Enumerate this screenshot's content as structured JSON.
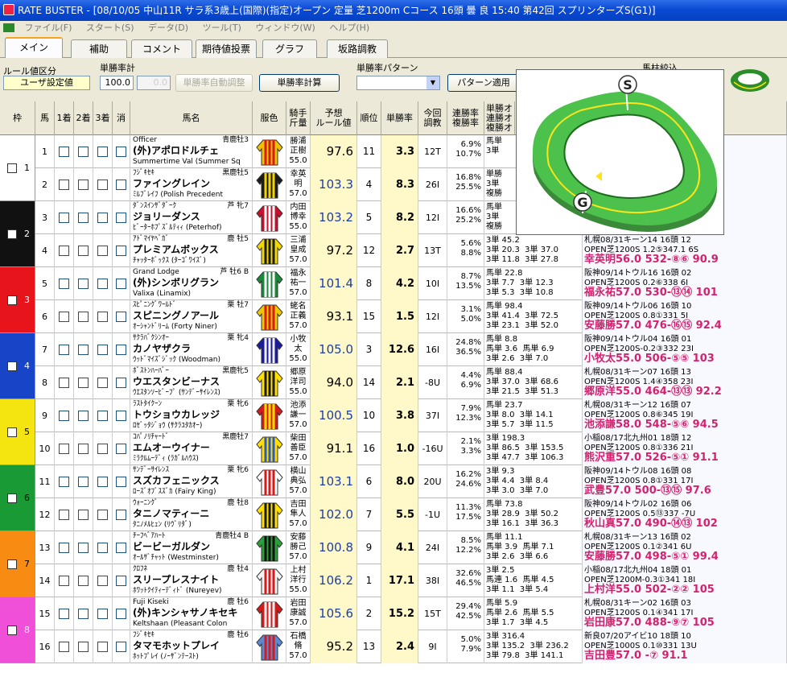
{
  "title": "RATE BUSTER - [08/10/05 中山11R サラ系3歳上(国際)(指定)オープン 定量 芝1200m Cコース 16頭 曇 良 15:40 第42回 スプリンターズS(G1)]",
  "menu": [
    "ファイル(F)",
    "スタート(S)",
    "データ(D)",
    "ツール(T)",
    "ウィンドウ(W)",
    "ヘルプ(H)"
  ],
  "tabs": [
    "メイン",
    "補助",
    "コメント",
    "期待値投票",
    "グラフ",
    "坂路調教"
  ],
  "toolbar": {
    "rule_label": "ルール値区分",
    "rule_value": "ユーザ設定値",
    "tansho_label": "単勝率計",
    "tansho_value": "100.0",
    "tansho_value2": "0.0",
    "auto_adjust": "単勝率自動調整",
    "calc": "単勝率計算",
    "pattern_label": "単勝率パターン",
    "pattern_apply": "パターン適用",
    "horse_filter": "馬柱絞込"
  },
  "headers": [
    "枠",
    "馬",
    "1着",
    "2着",
    "3着",
    "消",
    "馬名",
    "服色",
    "騎手\n斤量",
    "予想\nルール値",
    "順位",
    "単勝率",
    "今回\n調教",
    "連勝率\n複勝率",
    "単勝オ\n連勝オ\n複勝オ"
  ],
  "colors": {
    "frame": [
      "#ffffff",
      "#111111",
      "#e8141c",
      "#1844c8",
      "#f4e410",
      "#1a9a34",
      "#f88c12",
      "#f050d8"
    ]
  },
  "frames": [
    "1",
    "2",
    "3",
    "4",
    "5",
    "6",
    "7",
    "8"
  ],
  "rows": [
    {
      "no": "1",
      "sire": "Officer",
      "sex": "青鹿牡3",
      "name": "(外)アポロドルチェ",
      "dam": "Summertime Val (Summer Sq",
      "jockey": "勝浦\n正樹",
      "weight": "55.0",
      "rule": "97.6",
      "rank": "11",
      "odds": "3.3",
      "train": "12T",
      "rate1": "6.9%",
      "rate2": "10.7%",
      "bet": "馬単\n3単",
      "pv1": "11",
      "pv2": "B 17T",
      "pv3": "96.1"
    },
    {
      "no": "2",
      "sire": "ﾌｼﾞｷｾｷ",
      "sex": "黒鹿牡5",
      "name": "ファイングレイン",
      "dam": "ﾐﾙﾌﾞﾚｲﾌ (Polish Precedent",
      "jockey": "幸英\n明",
      "weight": "57.0",
      "rule": "103.3",
      "rank": "4",
      "odds": "8.3",
      "train": "26I",
      "rate1": "16.8%",
      "rate2": "25.5%",
      "bet": "単勝\n3単\n複勝",
      "pv1": "09",
      "pv2": "14I",
      "pv3": "98.1"
    },
    {
      "no": "3",
      "sire": "ﾀﾞﾝｽｲﾝｻﾞﾀﾞｰｸ",
      "sex": "芦 牝7",
      "name": "ジョリーダンス",
      "dam": "ﾋﾞｰﾀｰﾎﾌﾟｽﾞﾙﾃｨｨ (Peterhof)",
      "jockey": "内田\n博幸",
      "weight": "55.0",
      "rule": "103.2",
      "rank": "5",
      "odds": "8.2",
      "train": "12I",
      "rate1": "16.6%",
      "rate2": "25.2%",
      "bet": "馬単\n3単\n複勝",
      "pv1": "04",
      "pv2": "17I",
      "pv3": "102"
    },
    {
      "no": "4",
      "sire": "ｱﾄﾞﾏｲﾔﾍﾞｶﾞ",
      "sex": "鹿 牡5",
      "name": "プレミアムボックス",
      "dam": "ﾁｬｯﾀｰﾎﾞｯｸｽ (ﾀｰｺﾞﾜｲｽﾞ)",
      "jockey": "三浦\n皇成",
      "weight": "57.0",
      "rule": "97.2",
      "rank": "12",
      "odds": "2.7",
      "train": "13T",
      "rate1": "5.6%",
      "rate2": "8.8%",
      "bet": "3単 45.2\n3単 20.3  3単 37.0\n3単 11.8  3単 27.8",
      "pv1": "札幌08/31キーン14 16頭 12",
      "pv2": "OPEN芝1200S 1.2⑤347.1 6S",
      "pv3": "幸英明56.0 532-⑧⑥ 90.9"
    },
    {
      "no": "5",
      "sire": "Grand Lodge",
      "sex": "芦 牡6 B",
      "name": "(外)シンボリグラン",
      "dam": "Valixa (Linamix)",
      "jockey": "福永\n祐一",
      "weight": "57.0",
      "rule": "101.4",
      "rank": "8",
      "odds": "4.2",
      "train": "10I",
      "rate1": "8.7%",
      "rate2": "13.5%",
      "bet": "馬単 22.8\n3単 7.7  3単 12.3\n3単 5.3  3単 10.8",
      "pv1": "阪神09/14トウル16 16頭 02",
      "pv2": "OPEN芝1200S 0.2⑥338 6I",
      "pv3": "福永祐57.0 530-⑬⑭ 101"
    },
    {
      "no": "6",
      "sire": "ｽﾋﾟﾆﾝｸﾞﾜｰﾙﾄﾞ",
      "sex": "栗 牡7",
      "name": "スピニングノアール",
      "dam": "ｵｰｼｬﾝﾄﾞﾘｰﾑ (Forty Niner)",
      "jockey": "蛯名\n正義",
      "weight": "57.0",
      "rule": "93.1",
      "rank": "15",
      "odds": "1.5",
      "train": "12I",
      "rate1": "3.1%",
      "rate2": "5.0%",
      "bet": "馬単 98.4\n3単 41.4  3単 72.5\n3単 23.1  3単 52.0",
      "pv1": "阪神09/14トウル06 16頭 10",
      "pv2": "OPEN芝1200S 0.8①331 5I",
      "pv3": "安藤勝57.0 476-⑯⑮ 92.4"
    },
    {
      "no": "7",
      "sire": "ｻｸﾗﾊﾞｸｼﾝｵｰ",
      "sex": "栗 牝4",
      "name": "カノヤザクラ",
      "dam": "ｳｯﾄﾞﾏｲｽﾞｼﾞｯｸ (Woodman)",
      "jockey": "小牧\n太",
      "weight": "55.0",
      "rule": "105.0",
      "rank": "3",
      "odds": "12.6",
      "train": "16I",
      "rate1": "24.8%",
      "rate2": "36.5%",
      "bet": "馬単 8.8\n馬単 3.6  馬単 6.9\n3単 2.6  3単 7.0",
      "pv1": "阪神09/14トウル04 16頭 01",
      "pv2": "OPEN芝1200S-0.2③332 23I",
      "pv3": "小牧太55.0 506-⑤⑤ 103"
    },
    {
      "no": "8",
      "sire": "ﾎﾞｽﾄﾝﾊｰﾊﾞｰ",
      "sex": "黒鹿牝5",
      "name": "ウエスタンビーナス",
      "dam": "ｳｴｽﾀﾝｿｰﾋﾞｰﾌﾟ (ｻﾝﾃﾞｰｻｲﾚﾝｽ)",
      "jockey": "郷原\n洋司",
      "weight": "55.0",
      "rule": "94.0",
      "rank": "14",
      "odds": "2.1",
      "train": "-8U",
      "rate1": "4.4%",
      "rate2": "6.9%",
      "bet": "馬単 88.4\n3単 37.0  3単 68.6\n3単 21.5  3単 51.3",
      "pv1": "札幌08/31キーン07 16頭 13",
      "pv2": "OPEN芝1200S 1.4④358 23I",
      "pv3": "郷原洋55.0 464-⑬⑬ 92.2"
    },
    {
      "no": "9",
      "sire": "ﾗｽﾄﾀｲｸｰﾝ",
      "sex": "栗 牝6",
      "name": "トウショウカレッジ",
      "dam": "ﾛｾﾞｯﾀｼﾞｮｳ (ｻｸﾗﾕﾀｶｵｰ)",
      "jockey": "池添\n謙一",
      "weight": "57.0",
      "rule": "100.5",
      "rank": "10",
      "odds": "3.8",
      "train": "37I",
      "rate1": "7.9%",
      "rate2": "12.3%",
      "bet": "馬単 23.7\n3単 8.0  3単 14.1\n3単 5.7  3単 11.5",
      "pv1": "札幌08/31キーン12 16頭 07",
      "pv2": "OPEN芝1200S 0.8⑥345 19I",
      "pv3": "池添謙58.0 548-⑤⑥ 94.5"
    },
    {
      "no": "10",
      "sire": "ｺﾊﾟﾉﾘﾁｬｰﾄﾞ",
      "sex": "黒鹿牡7",
      "name": "エムオーウイナー",
      "dam": "ﾐﾗｸﾙﾑｰﾃﾞｨ (ﾗｶﾞﾙﾊｳｽ)",
      "jockey": "柴田\n善臣",
      "weight": "57.0",
      "rule": "91.1",
      "rank": "16",
      "odds": "1.0",
      "train": "-16U",
      "rate1": "2.1%",
      "rate2": "3.3%",
      "bet": "3単 198.3\n3単 86.5  3単 153.5\n3単 47.7  3単 106.3",
      "pv1": "小稲08/17北九州01 18頭 12",
      "pv2": "OPEN芝1200S 0.8①336 21I",
      "pv3": "熊沢重57.0 526-⑤① 91.1"
    },
    {
      "no": "11",
      "sire": "ｻﾝﾃﾞｰｻｲﾚﾝｽ",
      "sex": "栗 牝6",
      "name": "スズカフェニックス",
      "dam": "ﾛｰｽﾞｵﾌﾞｽｽﾞｶ (Fairy King)",
      "jockey": "横山\n典弘",
      "weight": "57.0",
      "rule": "103.1",
      "rank": "6",
      "odds": "8.0",
      "train": "20U",
      "rate1": "16.2%",
      "rate2": "24.6%",
      "bet": "3単 9.3\n3単 4.4  3単 8.4\n3単 3.0  3単 7.0",
      "pv1": "阪神09/14トウル08 16頭 08",
      "pv2": "OPEN芝1200S 0.8①331 17I",
      "pv3": "武豊57.0 500-⑬⑮ 97.6"
    },
    {
      "no": "12",
      "sire": "ｳｫｰﾆﾝｸﾞ",
      "sex": "鹿 牡8",
      "name": "タニノマティーニ",
      "dam": "ﾀﾆﾉﾒﾙﾋｪﾝ (ﾘｳﾞﾘﾀﾞ)",
      "jockey": "吉田\n隼人",
      "weight": "57.0",
      "rule": "102.0",
      "rank": "7",
      "odds": "5.5",
      "train": "-1U",
      "rate1": "11.3%",
      "rate2": "17.5%",
      "bet": "馬単 73.8\n3単 28.9  3単 50.2\n3単 16.1  3単 36.3",
      "pv1": "阪神09/14トウル02 16頭 06",
      "pv2": "OPEN芝1200S 0.5⑬337 -7U",
      "pv3": "秋山真57.0 490-⑭⑬ 102"
    },
    {
      "no": "13",
      "sire": "ﾁｰﾌﾍﾞｱﾊｰﾄ",
      "sex": "青鹿牡4 B",
      "name": "ビービーガルダン",
      "dam": "ｵｰﾙｻﾞﾁｬｯﾄ (Westminster)",
      "jockey": "安藤\n勝己",
      "weight": "57.0",
      "rule": "100.8",
      "rank": "9",
      "odds": "4.1",
      "train": "24I",
      "rate1": "8.5%",
      "rate2": "12.2%",
      "bet": "馬単 11.1\n馬単 3.9  馬単 7.1\n3単 2.6  3単 6.6",
      "pv1": "札幌08/31キーン13 16頭 02",
      "pv2": "OPEN芝1200S 0.1②341 6U",
      "pv3": "安藤勝57.0 498-⑤① 99.4"
    },
    {
      "no": "14",
      "sire": "ｸﾛﾌﾈ",
      "sex": "鹿 牡4",
      "name": "スリープレスナイト",
      "dam": "ﾎﾜｯﾄｸｲﾃｨｰﾃﾞｨﾄﾞ (Nureyev)",
      "jockey": "上村\n洋行",
      "weight": "55.0",
      "rule": "106.2",
      "rank": "1",
      "odds": "17.1",
      "train": "38I",
      "rate1": "32.6%",
      "rate2": "46.5%",
      "bet": "3単 2.5\n馬連 1.6  馬単 4.5\n3単 1.1  3単 5.4",
      "pv1": "小稲08/17北九州04 18頭 01",
      "pv2": "OPEN芝1200M-0.3①341 18I",
      "pv3": "上村洋55.0 502-②② 105"
    },
    {
      "no": "15",
      "sire": "Fuji Kiseki",
      "sex": "鹿 牡6",
      "name": "(外)キンシャサノキセキ",
      "dam": "Keltshaan (Pleasant Colon",
      "jockey": "岩田\n康誠",
      "weight": "57.0",
      "rule": "105.6",
      "rank": "2",
      "odds": "15.2",
      "train": "15T",
      "rate1": "29.4%",
      "rate2": "42.5%",
      "bet": "馬単 5.9\n馬単 2.6  馬単 5.5\n3単 1.7  3単 4.5",
      "pv1": "札幌08/31キーン02 16頭 03",
      "pv2": "OPEN芝1200S 0.1④341 17I",
      "pv3": "岩田康57.0 488-⑨⑦ 105"
    },
    {
      "no": "16",
      "sire": "ﾌｼﾞｷｾｷ",
      "sex": "鹿 牡6",
      "name": "タマモホットプレイ",
      "dam": "ﾎｯﾄﾌﾟﾚｲ (ﾉｰｻﾞﾝﾃｰｽﾄ)",
      "jockey": "石橋\n脩",
      "weight": "57.0",
      "rule": "95.2",
      "rank": "13",
      "odds": "2.4",
      "train": "9I",
      "rate1": "5.0%",
      "rate2": "7.9%",
      "bet": "3単 316.4\n3単 135.2  3単 236.2\n3単 79.8  3単 141.1",
      "pv1": "新良07/20アイビ10 18頭 10",
      "pv2": "OPEN芝1000S 0.1⑩331 13U",
      "pv3": "吉田豊57.0 -⑦ 91.1"
    }
  ],
  "course_labels": {
    "start": "S",
    "goal": "G"
  }
}
